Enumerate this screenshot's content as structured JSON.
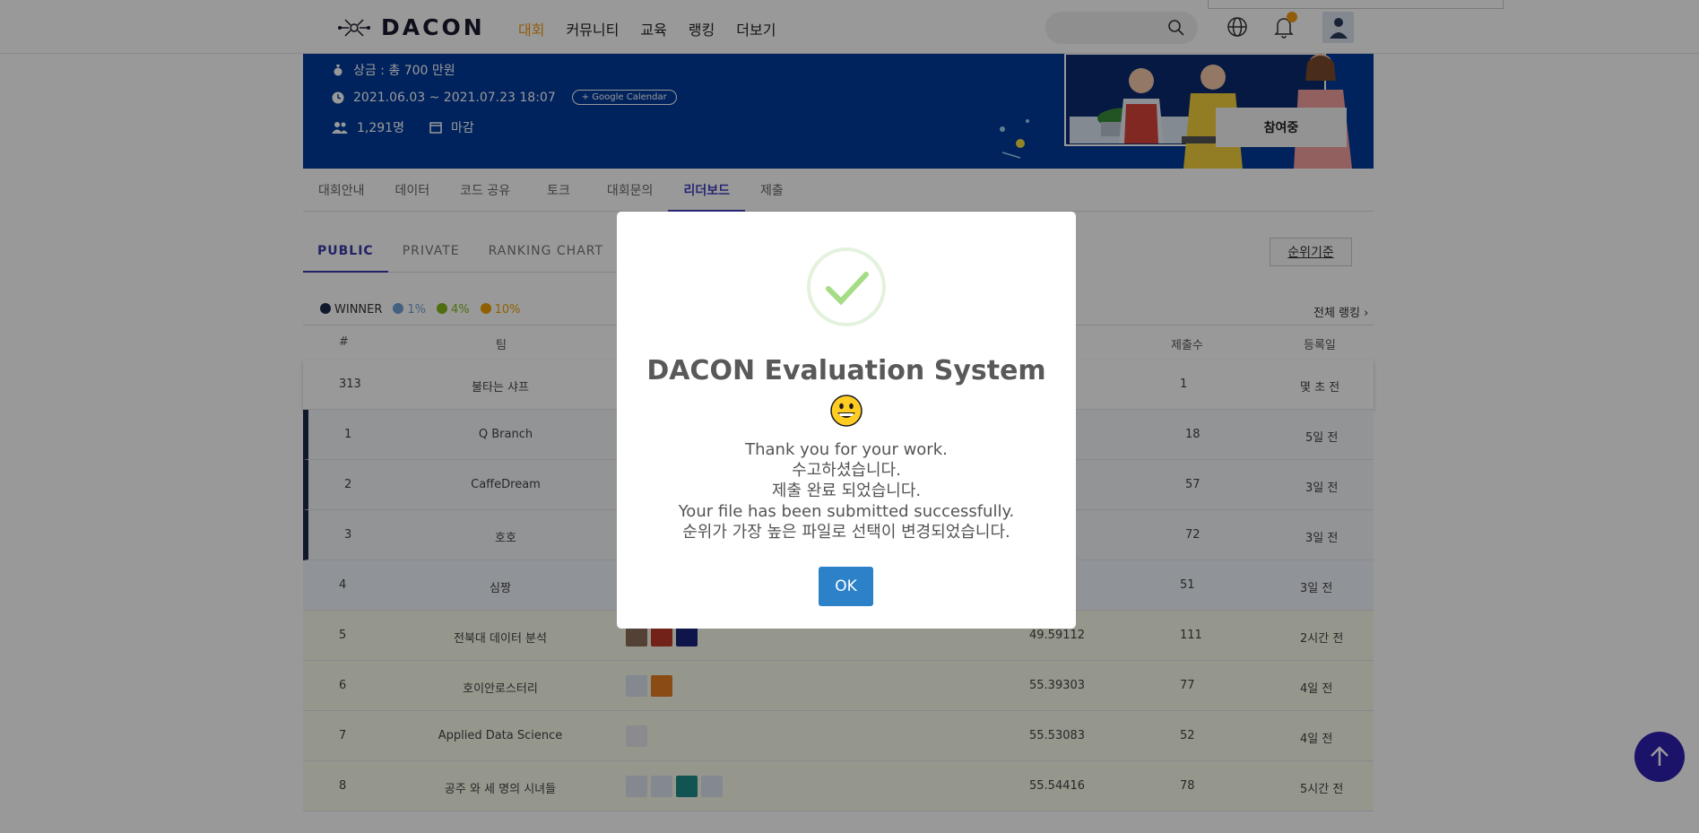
{
  "nav": {
    "logo_text": "DACON",
    "menu": [
      "대회",
      "커뮤니티",
      "교육",
      "랭킹",
      "더보기"
    ],
    "active_index": 0,
    "notification_color": "#f39c12"
  },
  "banner": {
    "prize": "상금 : 총 700 만원",
    "period": "2021.06.03 ~ 2021.07.23 18:07",
    "google_calendar": "+ Google Calendar",
    "participants": "1,291명",
    "status": "마감",
    "join_button": "참여중",
    "bg_color": "#003a9b"
  },
  "tabs": [
    "대회안내",
    "데이터",
    "코드 공유",
    "토크",
    "대회문의",
    "리더보드",
    "제출"
  ],
  "active_tab": "리더보드",
  "subtabs": [
    "PUBLIC",
    "PRIVATE",
    "RANKING CHART"
  ],
  "rank_criteria_button": "순위기준",
  "legend": [
    {
      "label": "WINNER",
      "color": "#1c2a4a"
    },
    {
      "label": "1%",
      "color": "#6fa0d4"
    },
    {
      "label": "4%",
      "color": "#82b81a"
    },
    {
      "label": "10%",
      "color": "#f0a000"
    }
  ],
  "all_ranking_link": "전체 랭킹 ›",
  "table": {
    "headers": {
      "rank": "#",
      "team": "팀",
      "submissions": "제출수",
      "date": "등록일"
    },
    "my_row": {
      "rank": "313",
      "team": "불타는 샤프",
      "score": "",
      "submissions": "1",
      "date": "몇 초 전"
    },
    "rows": [
      {
        "rank": "1",
        "team": "Q Branch",
        "score": "",
        "submissions": "18",
        "date": "5일 전"
      },
      {
        "rank": "2",
        "team": "CaffeDream",
        "score": "",
        "submissions": "57",
        "date": "3일 전"
      },
      {
        "rank": "3",
        "team": "호호",
        "score": "",
        "submissions": "72",
        "date": "3일 전"
      },
      {
        "rank": "4",
        "team": "심짱",
        "score": "",
        "submissions": "51",
        "date": "3일 전"
      },
      {
        "rank": "5",
        "team": "전북대 데이터 분석",
        "score": "49.59112",
        "submissions": "111",
        "date": "2시간 전"
      },
      {
        "rank": "6",
        "team": "호이안로스터리",
        "score": "55.39303",
        "submissions": "77",
        "date": "4일 전"
      },
      {
        "rank": "7",
        "team": "Applied Data Science",
        "score": "55.53083",
        "submissions": "52",
        "date": "4일 전"
      },
      {
        "rank": "8",
        "team": "공주 와 세 명의 시녀들",
        "score": "55.54416",
        "submissions": "78",
        "date": "5시간 전"
      }
    ]
  },
  "modal": {
    "title": "DACON Evaluation System",
    "lines": [
      "Thank you for your work.",
      "수고하셨습니다.",
      "제출 완료 되었습니다.",
      "Your file has been submitted successfully.",
      "순위가 가장 높은 파일로 선택이 변경되었습니다."
    ],
    "ok_button": "OK",
    "check_color": "#a5dc86",
    "ok_color": "#2d81c9"
  }
}
